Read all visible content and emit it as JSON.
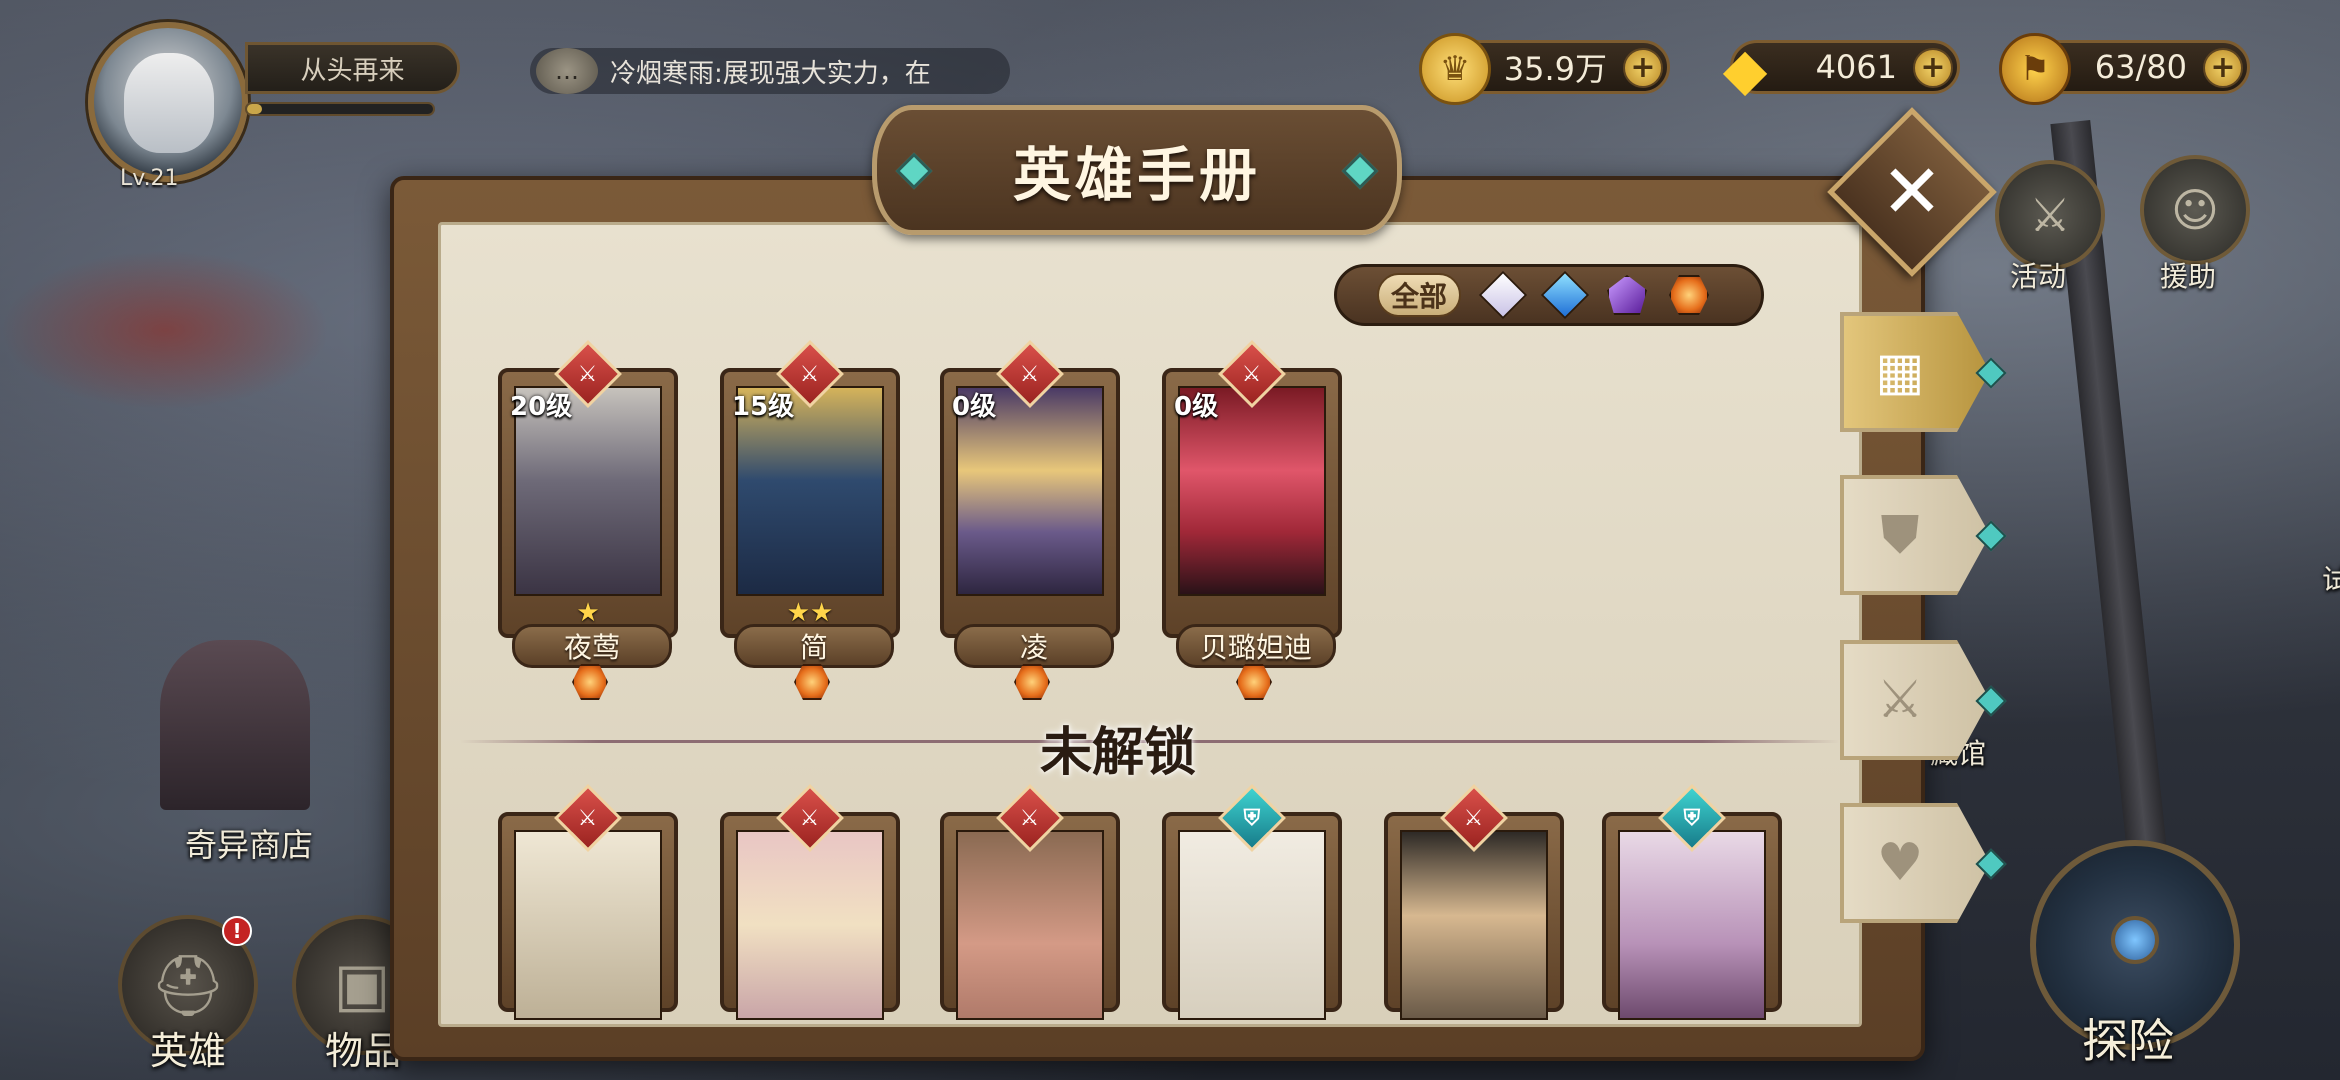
{
  "player": {
    "level_label": "Lv.21",
    "name_button": "从头再来",
    "xp_fraction": 0.08
  },
  "chat": {
    "icon": "speech-bubble-icon",
    "message": "冷烟寒雨:展现强大实力，在"
  },
  "currencies": {
    "gold": {
      "icon": "gold-coin-icon",
      "value": "35.9万"
    },
    "diamond": {
      "icon": "diamond-icon",
      "value": "4061"
    },
    "stamina": {
      "icon": "stamina-icon",
      "value": "63/80"
    }
  },
  "side_buttons": {
    "activity": "活动",
    "assist": "援助",
    "museum_partial": "藏馆",
    "far_right_partial": "试"
  },
  "left_area": {
    "shop_label": "奇异商店"
  },
  "bottom_nav": {
    "hero": "英雄",
    "items": "物品",
    "explore": "探险",
    "hero_badge": "!"
  },
  "panel": {
    "title": "英雄手册",
    "close_icon": "✕",
    "filter": {
      "all_label": "全部",
      "options": [
        {
          "name": "white",
          "color": "#e8e4f4"
        },
        {
          "name": "blue",
          "color": "#39a9f0"
        },
        {
          "name": "purple",
          "color": "#8a3cd0"
        },
        {
          "name": "orange",
          "color": "#f08a1e",
          "selected": true
        }
      ]
    },
    "unlocked_heroes": [
      {
        "name": "夜莺",
        "level": "20级",
        "stars": "★",
        "role": "sword"
      },
      {
        "name": "简",
        "level": "15级",
        "stars": "★★",
        "role": "sword"
      },
      {
        "name": "凌",
        "level": "0级",
        "stars": "",
        "role": "sword"
      },
      {
        "name": "贝璐妲迪",
        "level": "0级",
        "stars": "",
        "role": "sword"
      }
    ],
    "locked_title": "未解锁",
    "locked_heroes": [
      {
        "role": "sword"
      },
      {
        "role": "sword"
      },
      {
        "role": "sword"
      },
      {
        "role": "shield"
      },
      {
        "role": "sword"
      },
      {
        "role": "shield"
      }
    ],
    "tabs": [
      {
        "icon": "grid-icon",
        "active": true
      },
      {
        "icon": "shield-icon",
        "active": false
      },
      {
        "icon": "sword-icon",
        "active": false
      },
      {
        "icon": "heart-icon",
        "active": false
      }
    ]
  }
}
